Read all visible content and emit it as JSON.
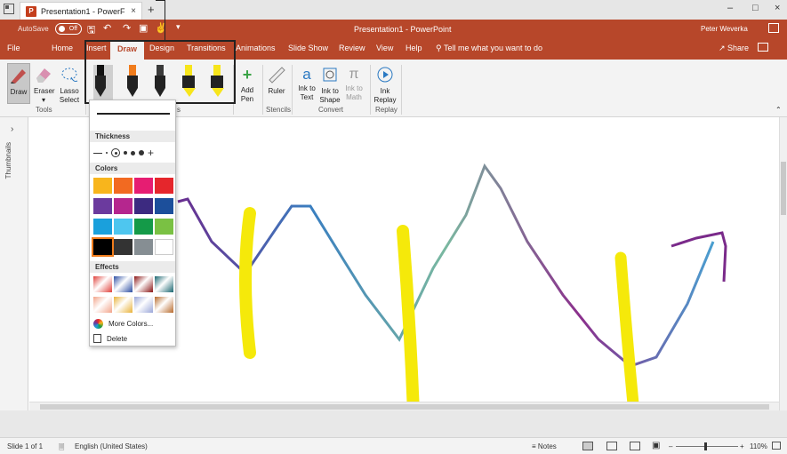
{
  "browser_tab": {
    "title": "Presentation1 - PowerF",
    "close": "×",
    "new_tab": "+"
  },
  "window_controls": {
    "minimize": "–",
    "maximize": "□",
    "close": "×"
  },
  "titlebar": {
    "autosave_label": "AutoSave",
    "autosave_state": "Off",
    "doc_title": "Presentation1 - PowerPoint",
    "user": "Peter Weverka"
  },
  "menu_tabs": [
    "File",
    "Home",
    "Insert",
    "Draw",
    "Design",
    "Transitions",
    "Animations",
    "Slide Show",
    "Review",
    "View",
    "Help"
  ],
  "active_tab": "Draw",
  "tell_me": "Tell me what you want to do",
  "share": "Share",
  "ribbon": {
    "tools": {
      "draw": "Draw",
      "eraser": "Eraser",
      "lasso_1": "Lasso",
      "lasso_2": "Select",
      "group": "Tools"
    },
    "pens": [
      {
        "color": "#111111",
        "type": "pen"
      },
      {
        "color": "#f07c1c",
        "type": "pen"
      },
      {
        "color": "#3a3a3a",
        "type": "pen"
      },
      {
        "color": "#f7e51b",
        "type": "highlighter"
      },
      {
        "color": "#f7e51b",
        "type": "highlighter"
      },
      {
        "color": "#2b8fc9",
        "type": "pen"
      }
    ],
    "pens_group_fragment": "s",
    "add_pen_1": "Add",
    "add_pen_2": "Pen",
    "ruler": "Ruler",
    "stencils_group": "Stencils",
    "ink_to_text_1": "Ink to",
    "ink_to_text_2": "Text",
    "ink_to_shape_1": "Ink to",
    "ink_to_shape_2": "Shape",
    "ink_to_math_1": "Ink to",
    "ink_to_math_2": "Math",
    "convert_group": "Convert",
    "ink_replay_1": "Ink",
    "ink_replay_2": "Replay",
    "replay_group": "Replay"
  },
  "thumbnails_label": "Thumbnails",
  "dropdown": {
    "thickness_header": "Thickness",
    "colors_header": "Colors",
    "effects_header": "Effects",
    "more_colors": "More Colors...",
    "delete": "Delete",
    "colors": [
      "#f8b51c",
      "#f26a21",
      "#e61d72",
      "#e5262c",
      "#6b3a9e",
      "#b5268e",
      "#3c2a80",
      "#1c4f9b",
      "#1aa0dc",
      "#4ec6ef",
      "#149a48",
      "#7ac143",
      "#000000",
      "#333333",
      "#868e93",
      "#ffffff"
    ],
    "effects": [
      "#e0403a",
      "#2d4fa3",
      "#8a1414",
      "#1a6670",
      "#f2a48a",
      "#e8b23a",
      "#9aa6d8",
      "#b86a2c"
    ]
  },
  "status": {
    "slide": "Slide 1 of 1",
    "language": "English (United States)",
    "notes": "Notes",
    "zoom": "110%"
  }
}
